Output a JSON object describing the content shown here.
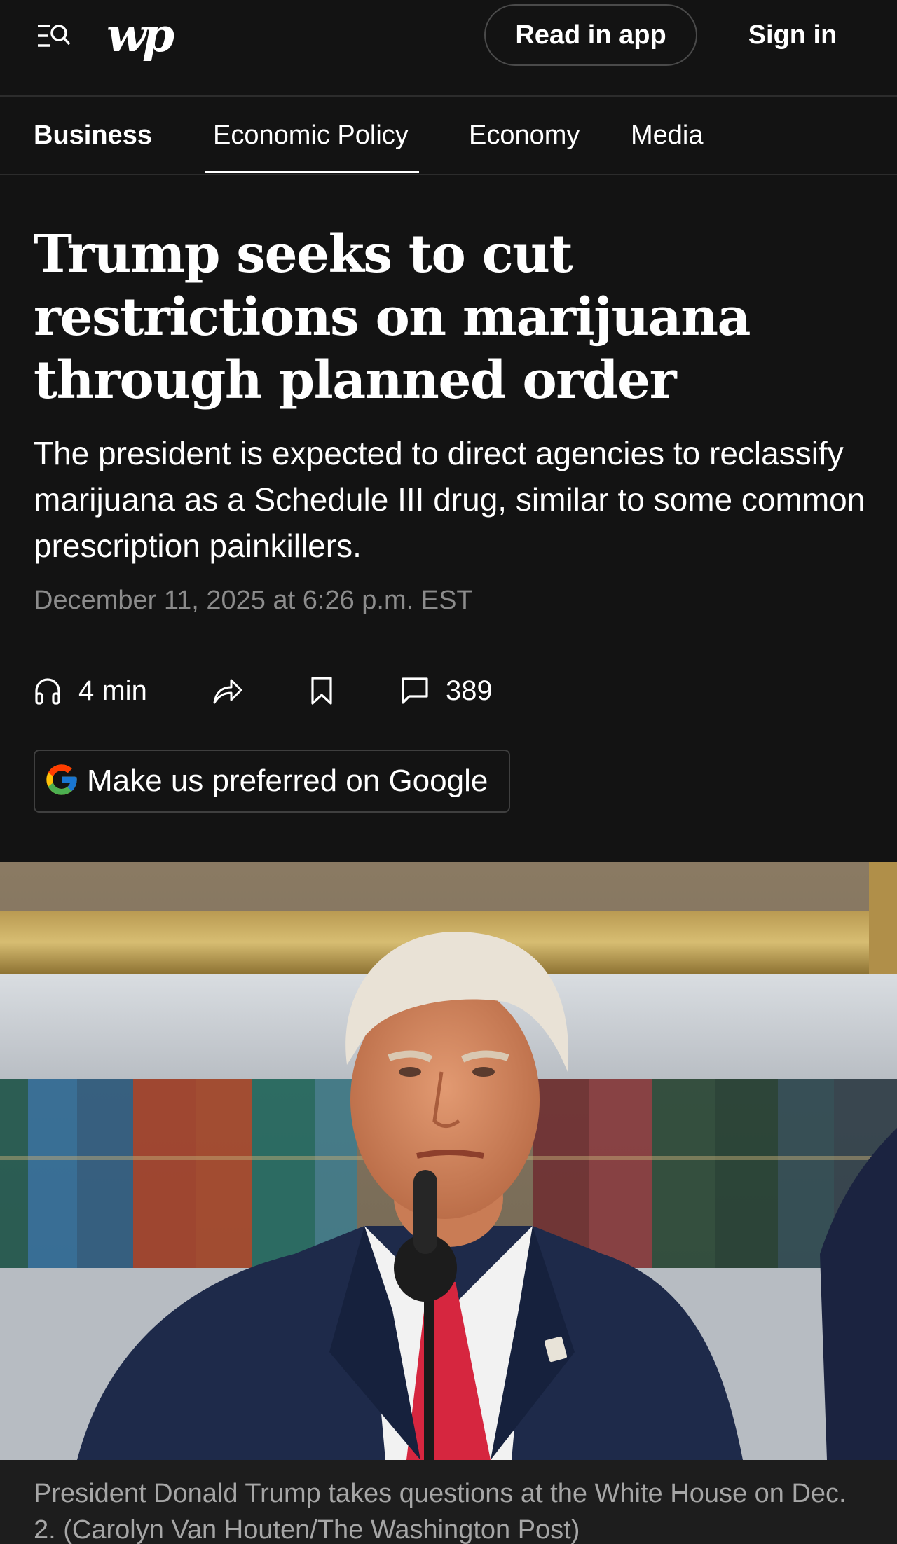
{
  "header": {
    "logo_text": "wp",
    "read_in_app": "Read in app",
    "sign_in": "Sign in",
    "icons": [
      "menu-search-icon"
    ]
  },
  "section_nav": {
    "items": [
      {
        "label": "Business",
        "active_section": true
      },
      {
        "label": "Economic Policy",
        "selected": true
      },
      {
        "label": "Economy"
      },
      {
        "label": "Media"
      }
    ]
  },
  "article": {
    "headline": "Trump seeks to cut restrictions on marijuana through planned order",
    "dek": "The president is expected to direct agencies to reclassify marijuana as a Schedule III drug, similar to some common prescription painkillers.",
    "dateline": "December 11, 2025 at 6:26 p.m. EST",
    "actions": {
      "listen_label": "4 min",
      "comments_count": "389",
      "icons": [
        "headphones-icon",
        "share-icon",
        "bookmark-icon",
        "comment-icon"
      ]
    },
    "google_button": "Make us preferred on Google",
    "photo_caption": "President Donald Trump takes questions at the White House on Dec. 2. (Carolyn Van Houten/The Washington Post)"
  },
  "colors": {
    "background": "#131313",
    "text": "#ffffff",
    "muted": "#8c8c8c",
    "border": "#2c2c2c"
  }
}
